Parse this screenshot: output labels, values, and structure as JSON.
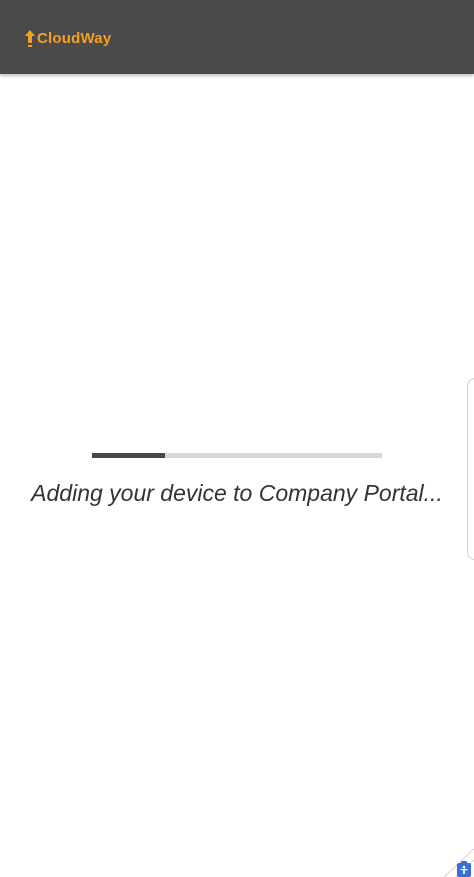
{
  "header": {
    "brand": "CloudWay",
    "brand_color": "#f5a021",
    "background_color": "#4a4a4a",
    "logo_icon": "cloudway-logo-icon"
  },
  "enrollment": {
    "status_text": "Adding your device to Company Portal...",
    "progress_fraction": 0.25
  },
  "system_overlays": {
    "edge_panel_handle": "edge-panel-handle",
    "accessibility_icon": "accessibility-icon",
    "accessibility_color": "#3a6fd8"
  }
}
